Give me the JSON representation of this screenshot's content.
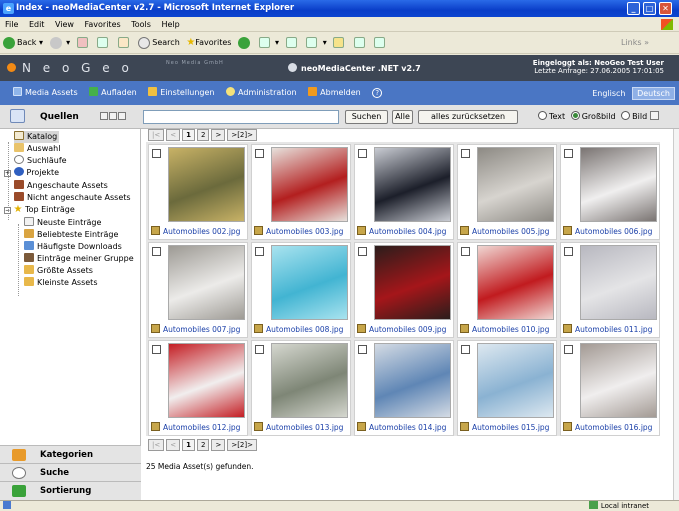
{
  "window": {
    "title": "Index - neoMediaCenter v2.7 - Microsoft Internet Explorer"
  },
  "menu": [
    "File",
    "Edit",
    "View",
    "Favorites",
    "Tools",
    "Help"
  ],
  "toolbar": {
    "back": "Back",
    "search": "Search",
    "favorites": "Favorites",
    "links": "Links"
  },
  "banner": {
    "brand": "N e o G e o",
    "brand_sub": "Neo Media GmbH",
    "app_title": "neoMediaCenter .NET v2.7",
    "login_line1": "Eingeloggt als: NeoGeo Test User",
    "login_line2": "Letzte Anfrage: 27.06.2005 17:01:05"
  },
  "nav": {
    "items": [
      "Media Assets",
      "Aufladen",
      "Einstellungen",
      "Administration",
      "Abmelden"
    ],
    "lang": [
      "Englisch",
      "Deutsch"
    ]
  },
  "query": {
    "label": "Quellen",
    "search_value": "",
    "search_btn": "Suchen",
    "all_btn": "Alle",
    "reset_btn": "alles zurücksetzen",
    "radios": [
      "Text",
      "Großbild",
      "Bild"
    ],
    "selected_radio": "Großbild"
  },
  "tree": [
    "Katalog",
    "Auswahl",
    "Suchläufe",
    "Projekte",
    "Angeschaute Assets",
    "Nicht angeschaute Assets",
    "Top Einträge",
    "Neuste Einträge",
    "Beliebteste Einträge",
    "Häufigste Downloads",
    "Einträge meiner Gruppe",
    "Größte Assets",
    "Kleinste Assets"
  ],
  "sections": [
    "Kategorien",
    "Suche",
    "Sortierung"
  ],
  "pager": [
    "|<",
    "<",
    "1",
    "2",
    ">",
    ">[2]>"
  ],
  "pager_current": "1",
  "assets": [
    {
      "name": "Automobiles 002.jpg",
      "c1": "#6b6a3c",
      "c2": "#c8b266"
    },
    {
      "name": "Automobiles 003.jpg",
      "c1": "#b31f1f",
      "c2": "#e7e1dc"
    },
    {
      "name": "Automobiles 004.jpg",
      "c1": "#1c1f2a",
      "c2": "#c9ccd3"
    },
    {
      "name": "Automobiles 005.jpg",
      "c1": "#d7d4cf",
      "c2": "#8d8a84"
    },
    {
      "name": "Automobiles 006.jpg",
      "c1": "#f0efef",
      "c2": "#7a7472"
    },
    {
      "name": "Automobiles 007.jpg",
      "c1": "#ecebe9",
      "c2": "#9d9a94"
    },
    {
      "name": "Automobiles 008.jpg",
      "c1": "#42b4d2",
      "c2": "#a9e3ef"
    },
    {
      "name": "Automobiles 009.jpg",
      "c1": "#a5161a",
      "c2": "#2b1d1b"
    },
    {
      "name": "Automobiles 010.jpg",
      "c1": "#c11b1f",
      "c2": "#f0d7d3"
    },
    {
      "name": "Automobiles 011.jpg",
      "c1": "#e4e4e6",
      "c2": "#b8b8c0"
    },
    {
      "name": "Automobiles 012.jpg",
      "c1": "#f1eeee",
      "c2": "#c41e24"
    },
    {
      "name": "Automobiles 013.jpg",
      "c1": "#7e8676",
      "c2": "#d5d7cf"
    },
    {
      "name": "Automobiles 014.jpg",
      "c1": "#5f86b5",
      "c2": "#d4dbe4"
    },
    {
      "name": "Automobiles 015.jpg",
      "c1": "#8ab2d2",
      "c2": "#dde8f0"
    },
    {
      "name": "Automobiles 016.jpg",
      "c1": "#f0eeee",
      "c2": "#a39a94"
    }
  ],
  "result_text": "25 Media Asset(s) gefunden.",
  "status": {
    "zone": "Local intranet"
  },
  "colors": {
    "nav_bg": "#4a76c4",
    "banner_bg": "#3d4654",
    "title_blue": "#0a3ec8",
    "link_blue": "#1a3fa8"
  }
}
